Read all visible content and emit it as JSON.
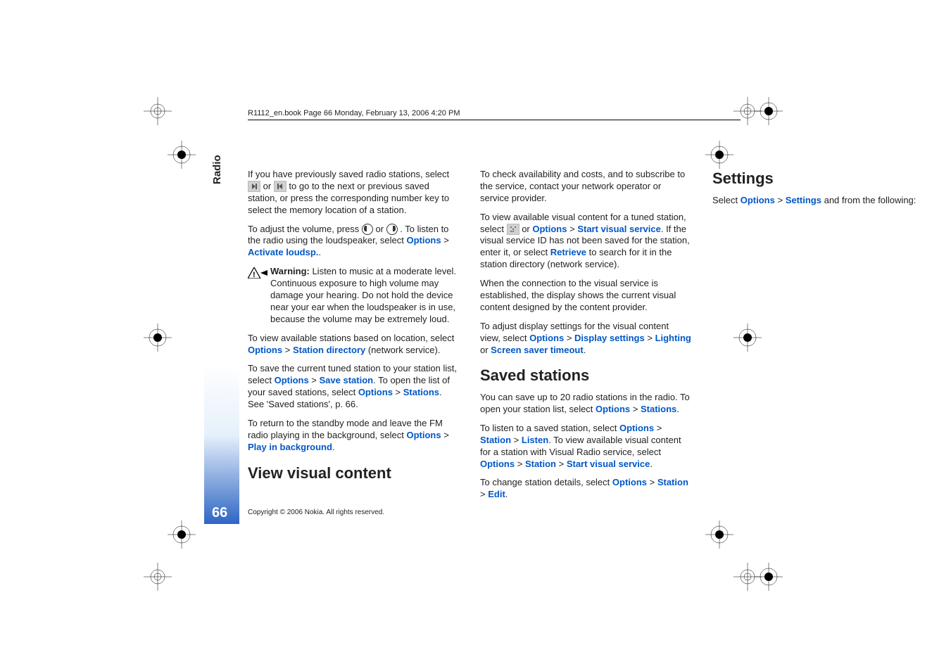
{
  "header": "R1112_en.book  Page 66  Monday, February 13, 2006  4:20 PM",
  "section_label": "Radio",
  "page_number": "66",
  "copyright": "Copyright © 2006 Nokia. All rights reserved.",
  "p1a": "If you have previously saved radio stations, select ",
  "p1b": " or ",
  "p1c": " to go to the next or previous saved station, or press the corresponding number key to select the memory location of a station.",
  "p2a": "To adjust the volume, press ",
  "p2b": " or ",
  "p2c": ". To listen to the radio using the loudspeaker, select ",
  "options": "Options",
  "gt": " > ",
  "activate_loudsp": "Activate loudsp.",
  "p2d": ".",
  "warning_label": "Warning:",
  "warning_text": " Listen to music at a moderate level. Continuous exposure to high volume may damage your hearing. Do not hold the device near your ear when the loudspeaker is in use, because the volume may be extremely loud.",
  "p3a": "To view available stations based on location, select ",
  "station_directory": "Station directory",
  "p3b": " (network service).",
  "p4a": "To save the current tuned station to your station list, select ",
  "save_station": "Save station",
  "p4b": ". To open the list of your saved stations, select ",
  "stations": "Stations",
  "p4c": ". See 'Saved stations', p. 66.",
  "p5a": "To return to the standby mode and leave the FM radio playing in the background, select ",
  "play_in_background": "Play in background",
  "p5b": ".",
  "h_view_visual": "View visual content",
  "p6": "To check availability and costs, and to subscribe to the service, contact your network operator or service provider.",
  "p7a": "To view available visual content for a tuned station, select ",
  "p7b": " or ",
  "start_visual_service": "Start visual service",
  "p7c": ". If the visual service ID has not been saved for the station, enter it, or select ",
  "retrieve": "Retrieve",
  "p7d": " to search for it in the station directory (network service).",
  "p8": "When the connection to the visual service is established, the display shows the current visual content designed by the content provider.",
  "p9a": "To adjust display settings for the visual content view, select ",
  "display_settings": "Display settings",
  "lighting": "Lighting",
  "or": " or ",
  "screen_saver_timeout": "Screen saver timeout",
  "p9b": ".",
  "h_saved_stations": "Saved stations",
  "p10a": "You can save up to 20 radio stations in the radio. To open your station list, select ",
  "p10b": ".",
  "p11a": "To listen to a saved station, select ",
  "station": "Station",
  "listen": "Listen",
  "p11b": ". To view available visual content for a station with Visual Radio service, select ",
  "p11c": ".",
  "p12a": "To change station details, select ",
  "edit": "Edit",
  "p12b": ".",
  "h_settings": "Settings",
  "p13a": "Select ",
  "settings": "Settings",
  "p13b": " and from the following:"
}
